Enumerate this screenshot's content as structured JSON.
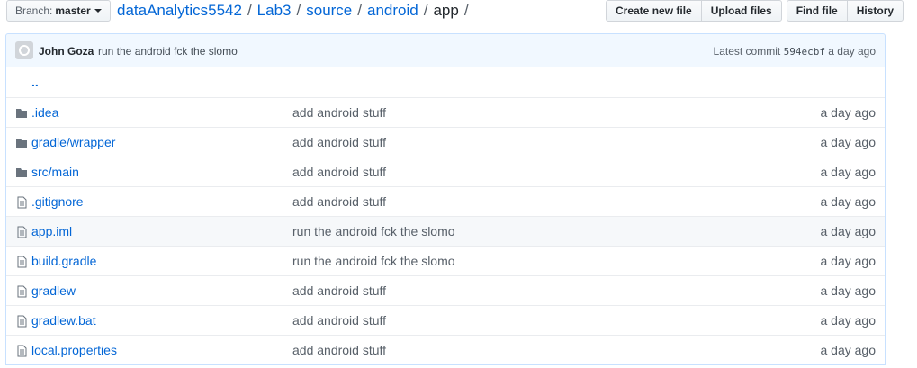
{
  "branch": {
    "label": "Branch:",
    "value": "master"
  },
  "breadcrumb": {
    "items": [
      "dataAnalytics5542",
      "Lab3",
      "source",
      "android"
    ],
    "current": "app",
    "trailing": "/"
  },
  "actions": {
    "create": "Create new file",
    "upload": "Upload files",
    "find": "Find file",
    "history": "History"
  },
  "commit": {
    "author": "John Goza",
    "message": "run the android fck the slomo",
    "prefix": "Latest commit",
    "sha": "594ecbf",
    "time": "a day ago"
  },
  "parent_link": "..",
  "files": [
    {
      "type": "dir",
      "name": ".idea",
      "message": "add android stuff",
      "age": "a day ago"
    },
    {
      "type": "dir",
      "name": "gradle/wrapper",
      "message": "add android stuff",
      "age": "a day ago"
    },
    {
      "type": "dir",
      "name": "src/main",
      "message": "add android stuff",
      "age": "a day ago"
    },
    {
      "type": "file",
      "name": ".gitignore",
      "message": "add android stuff",
      "age": "a day ago"
    },
    {
      "type": "file",
      "name": "app.iml",
      "message": "run the android fck the slomo",
      "age": "a day ago"
    },
    {
      "type": "file",
      "name": "build.gradle",
      "message": "run the android fck the slomo",
      "age": "a day ago"
    },
    {
      "type": "file",
      "name": "gradlew",
      "message": "add android stuff",
      "age": "a day ago"
    },
    {
      "type": "file",
      "name": "gradlew.bat",
      "message": "add android stuff",
      "age": "a day ago"
    },
    {
      "type": "file",
      "name": "local.properties",
      "message": "add android stuff",
      "age": "a day ago"
    }
  ],
  "colors": {
    "link": "#0366d6",
    "commit_bg": "#f1f8ff",
    "icon": "#6a737d"
  }
}
